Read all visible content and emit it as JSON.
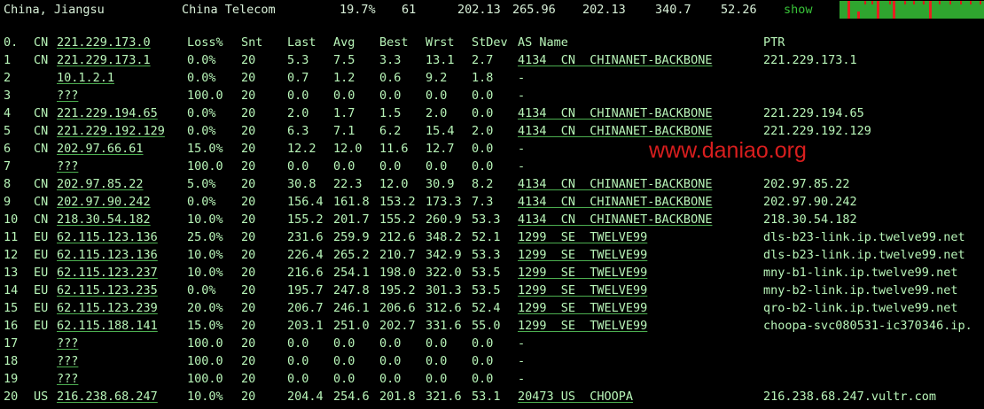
{
  "header": {
    "location": "China, Jiangsu",
    "isp": "China Telecom",
    "loss": "19.7%",
    "sent": "61",
    "last": "202.13",
    "avg": "265.96",
    "best": "202.13",
    "worst": "340.7",
    "stdev": "52.26",
    "show_label": "show",
    "sparkline_colors": {
      "ok": "#2fa52f",
      "loss": "#e82020"
    }
  },
  "columns": {
    "hop": "0.",
    "cc": "CN",
    "host": "221.229.173.0",
    "loss": "Loss%",
    "snt": "Snt",
    "last": "Last",
    "avg": "Avg",
    "best": "Best",
    "wrst": "Wrst",
    "stdev": "StDev",
    "as": "AS Name",
    "ptr": "PTR"
  },
  "rows": [
    {
      "hop": "1",
      "cc": "CN",
      "host": "221.229.173.1",
      "loss": "0.0%",
      "snt": "20",
      "last": "5.3",
      "avg": "7.5",
      "best": "3.3",
      "wrst": "13.1",
      "stdev": "2.7",
      "as": "4134  CN  CHINANET-BACKBONE",
      "ptr": "221.229.173.1"
    },
    {
      "hop": "2",
      "cc": "",
      "host": "10.1.2.1",
      "loss": "0.0%",
      "snt": "20",
      "last": "0.7",
      "avg": "1.2",
      "best": "0.6",
      "wrst": "9.2",
      "stdev": "1.8",
      "as": "-",
      "ptr": ""
    },
    {
      "hop": "3",
      "cc": "",
      "host": "???",
      "loss": "100.0",
      "snt": "20",
      "last": "0.0",
      "avg": "0.0",
      "best": "0.0",
      "wrst": "0.0",
      "stdev": "0.0",
      "as": "-",
      "ptr": ""
    },
    {
      "hop": "4",
      "cc": "CN",
      "host": "221.229.194.65",
      "loss": "0.0%",
      "snt": "20",
      "last": "2.0",
      "avg": "1.7",
      "best": "1.5",
      "wrst": "2.0",
      "stdev": "0.0",
      "as": "4134  CN  CHINANET-BACKBONE",
      "ptr": "221.229.194.65"
    },
    {
      "hop": "5",
      "cc": "CN",
      "host": "221.229.192.129",
      "loss": "0.0%",
      "snt": "20",
      "last": "6.3",
      "avg": "7.1",
      "best": "6.2",
      "wrst": "15.4",
      "stdev": "2.0",
      "as": "4134  CN  CHINANET-BACKBONE",
      "ptr": "221.229.192.129"
    },
    {
      "hop": "6",
      "cc": "CN",
      "host": "202.97.66.61",
      "loss": "15.0%",
      "snt": "20",
      "last": "12.2",
      "avg": "12.0",
      "best": "11.6",
      "wrst": "12.7",
      "stdev": "0.0",
      "as": "-",
      "ptr": ""
    },
    {
      "hop": "7",
      "cc": "",
      "host": "???",
      "loss": "100.0",
      "snt": "20",
      "last": "0.0",
      "avg": "0.0",
      "best": "0.0",
      "wrst": "0.0",
      "stdev": "0.0",
      "as": "-",
      "ptr": ""
    },
    {
      "hop": "8",
      "cc": "CN",
      "host": "202.97.85.22",
      "loss": "5.0%",
      "snt": "20",
      "last": "30.8",
      "avg": "22.3",
      "best": "12.0",
      "wrst": "30.9",
      "stdev": "8.2",
      "as": "4134  CN  CHINANET-BACKBONE",
      "ptr": "202.97.85.22"
    },
    {
      "hop": "9",
      "cc": "CN",
      "host": "202.97.90.242",
      "loss": "0.0%",
      "snt": "20",
      "last": "156.4",
      "avg": "161.8",
      "best": "153.2",
      "wrst": "173.3",
      "stdev": "7.3",
      "as": "4134  CN  CHINANET-BACKBONE",
      "ptr": "202.97.90.242"
    },
    {
      "hop": "10",
      "cc": "CN",
      "host": "218.30.54.182",
      "loss": "10.0%",
      "snt": "20",
      "last": "155.2",
      "avg": "201.7",
      "best": "155.2",
      "wrst": "260.9",
      "stdev": "53.3",
      "as": "4134  CN  CHINANET-BACKBONE",
      "ptr": "218.30.54.182"
    },
    {
      "hop": "11",
      "cc": "EU",
      "host": "62.115.123.136",
      "loss": "25.0%",
      "snt": "20",
      "last": "231.6",
      "avg": "259.9",
      "best": "212.6",
      "wrst": "348.2",
      "stdev": "52.1",
      "as": "1299  SE  TWELVE99",
      "ptr": "dls-b23-link.ip.twelve99.net"
    },
    {
      "hop": "12",
      "cc": "EU",
      "host": "62.115.123.136",
      "loss": "10.0%",
      "snt": "20",
      "last": "226.4",
      "avg": "265.2",
      "best": "210.7",
      "wrst": "342.9",
      "stdev": "53.3",
      "as": "1299  SE  TWELVE99",
      "ptr": "dls-b23-link.ip.twelve99.net"
    },
    {
      "hop": "13",
      "cc": "EU",
      "host": "62.115.123.237",
      "loss": "10.0%",
      "snt": "20",
      "last": "216.6",
      "avg": "254.1",
      "best": "198.0",
      "wrst": "322.0",
      "stdev": "53.5",
      "as": "1299  SE  TWELVE99",
      "ptr": "mny-b1-link.ip.twelve99.net"
    },
    {
      "hop": "14",
      "cc": "EU",
      "host": "62.115.123.235",
      "loss": "0.0%",
      "snt": "20",
      "last": "195.7",
      "avg": "247.8",
      "best": "195.2",
      "wrst": "301.3",
      "stdev": "53.5",
      "as": "1299  SE  TWELVE99",
      "ptr": "mny-b2-link.ip.twelve99.net"
    },
    {
      "hop": "15",
      "cc": "EU",
      "host": "62.115.123.239",
      "loss": "20.0%",
      "snt": "20",
      "last": "206.7",
      "avg": "246.1",
      "best": "206.6",
      "wrst": "312.6",
      "stdev": "52.4",
      "as": "1299  SE  TWELVE99",
      "ptr": "qro-b2-link.ip.twelve99.net"
    },
    {
      "hop": "16",
      "cc": "EU",
      "host": "62.115.188.141",
      "loss": "15.0%",
      "snt": "20",
      "last": "203.1",
      "avg": "251.0",
      "best": "202.7",
      "wrst": "331.6",
      "stdev": "55.0",
      "as": "1299  SE  TWELVE99",
      "ptr": "choopa-svc080531-ic370346.ip."
    },
    {
      "hop": "17",
      "cc": "",
      "host": "???",
      "loss": "100.0",
      "snt": "20",
      "last": "0.0",
      "avg": "0.0",
      "best": "0.0",
      "wrst": "0.0",
      "stdev": "0.0",
      "as": "-",
      "ptr": ""
    },
    {
      "hop": "18",
      "cc": "",
      "host": "???",
      "loss": "100.0",
      "snt": "20",
      "last": "0.0",
      "avg": "0.0",
      "best": "0.0",
      "wrst": "0.0",
      "stdev": "0.0",
      "as": "-",
      "ptr": ""
    },
    {
      "hop": "19",
      "cc": "",
      "host": "???",
      "loss": "100.0",
      "snt": "20",
      "last": "0.0",
      "avg": "0.0",
      "best": "0.0",
      "wrst": "0.0",
      "stdev": "0.0",
      "as": "-",
      "ptr": ""
    },
    {
      "hop": "20",
      "cc": "US",
      "host": "216.238.68.247",
      "loss": "10.0%",
      "snt": "20",
      "last": "204.4",
      "avg": "254.6",
      "best": "201.8",
      "wrst": "321.6",
      "stdev": "53.1",
      "as": "20473 US  CHOOPA",
      "ptr": "216.238.68.247.vultr.com"
    }
  ],
  "watermark": "www.daniao.org"
}
